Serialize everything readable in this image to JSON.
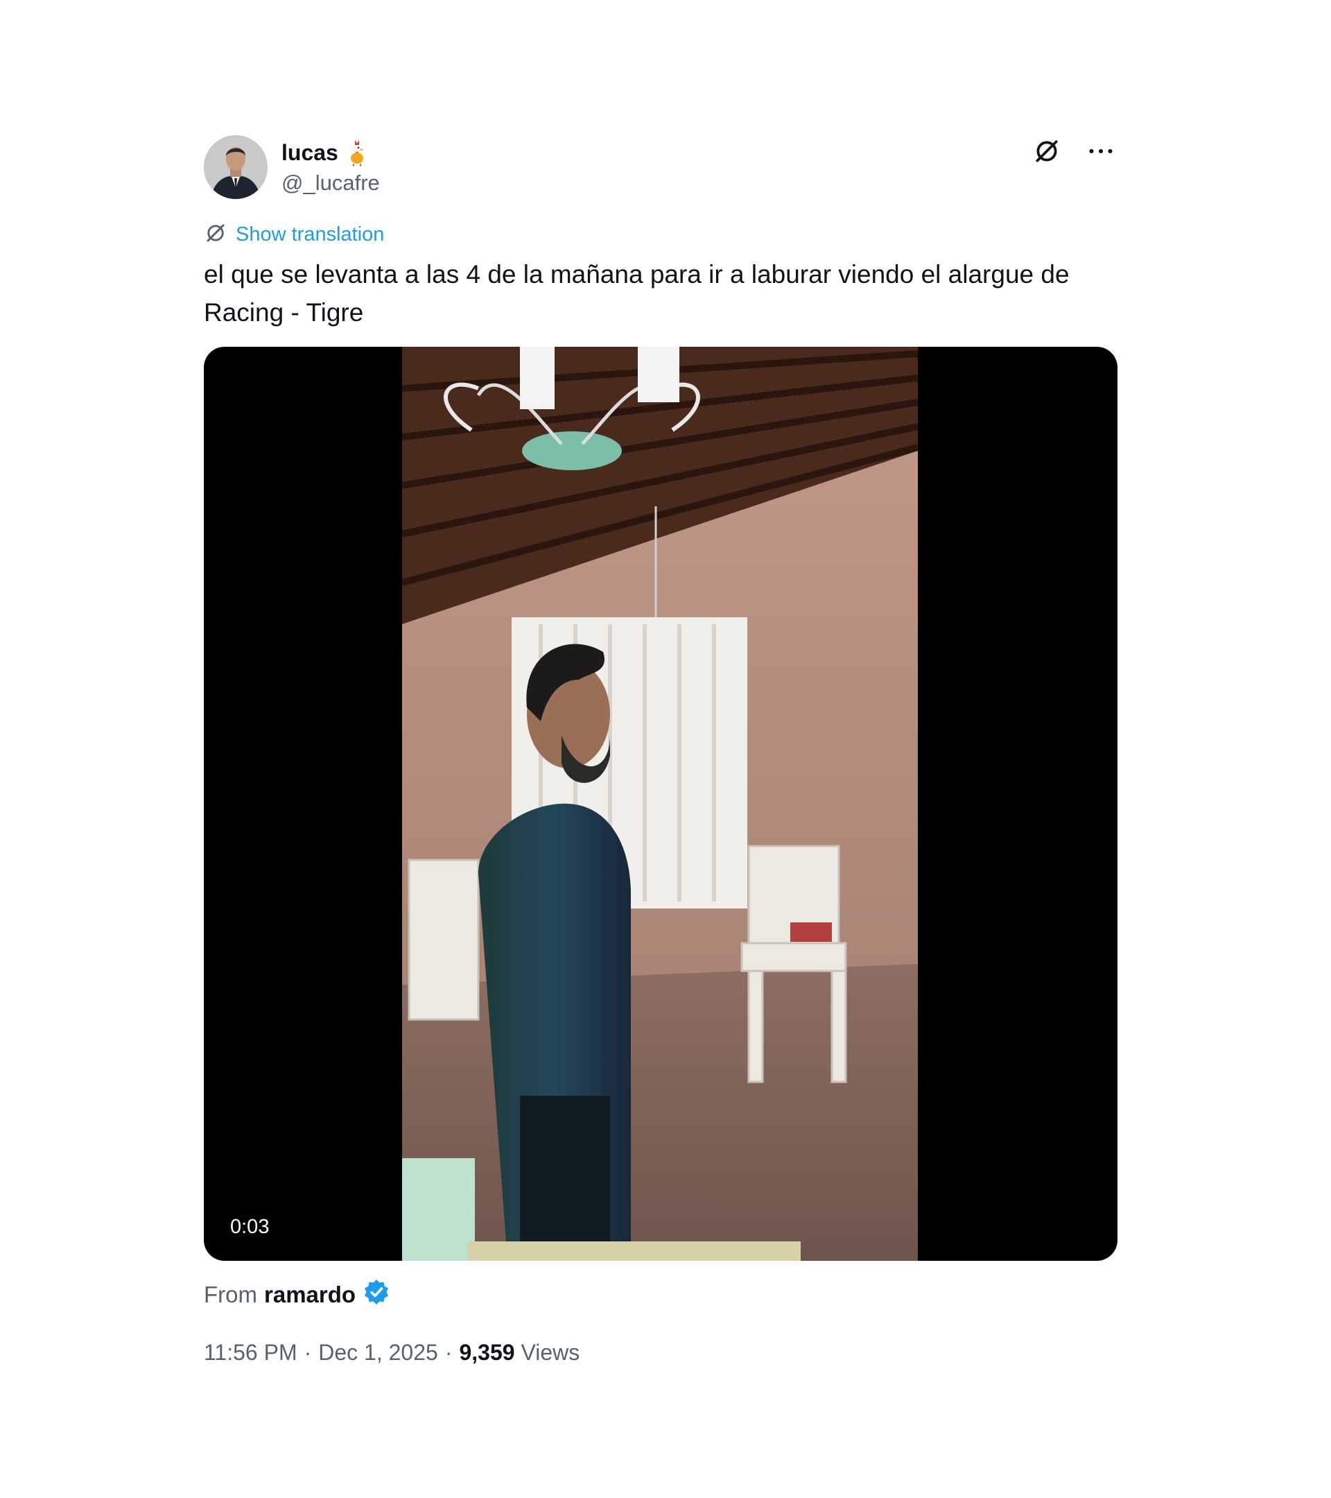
{
  "author": {
    "name": "lucas",
    "handle": "@_lucafre",
    "emoji_icon": "rooster-emoji-icon"
  },
  "actions": {
    "grok_icon": "grok-icon",
    "more_icon": "more-options-icon"
  },
  "translation": {
    "label": "Show translation"
  },
  "tweet": {
    "text": "el que se levanta a las 4 de la mañana para ir a laburar viendo el alargue de Racing - Tigre"
  },
  "media": {
    "type": "video",
    "duration": "0:03"
  },
  "attribution": {
    "from_label": "From",
    "user": "ramardo",
    "verified": true
  },
  "meta": {
    "time": "11:56 PM",
    "separator": "·",
    "date": "Dec 1, 2025",
    "views_count": "9,359",
    "views_label": "Views"
  },
  "colors": {
    "link_blue": "#1d9bf0",
    "secondary_text": "#536471",
    "primary_text": "#0f1419",
    "verified_blue": "#1d9bf0"
  }
}
